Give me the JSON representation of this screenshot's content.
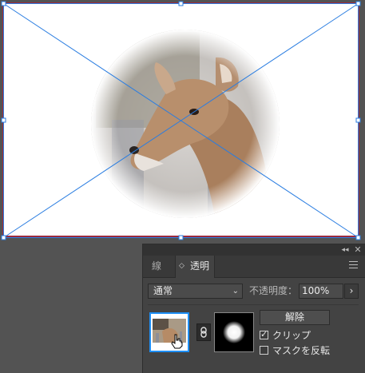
{
  "panel": {
    "titlebar": {
      "collapse_icon": "double-chevron-left-icon",
      "collapse_glyph": "◂◂",
      "close_icon": "close-icon",
      "close_glyph": "✕"
    },
    "tabs": [
      {
        "label": "線",
        "active": false
      },
      {
        "label": "透明",
        "active": true
      }
    ],
    "tab_updown_glyph": "◇",
    "menu_icon": "hamburger-menu-icon",
    "blend_mode": {
      "value": "通常",
      "chevron_glyph": "⌄"
    },
    "opacity": {
      "label": "不透明度：",
      "value": "100%",
      "arrow_glyph": "›"
    },
    "release_label": "解除",
    "clip": {
      "label": "クリップ",
      "checked": true,
      "tick_glyph": "✓"
    },
    "invert_mask": {
      "label": "マスクを反転",
      "checked": false
    }
  },
  "canvas": {
    "artboard_border_color": "#9b2a3e",
    "selection_color": "#2a7de1",
    "image_subject": "deer-photo-with-circular-vignette"
  }
}
